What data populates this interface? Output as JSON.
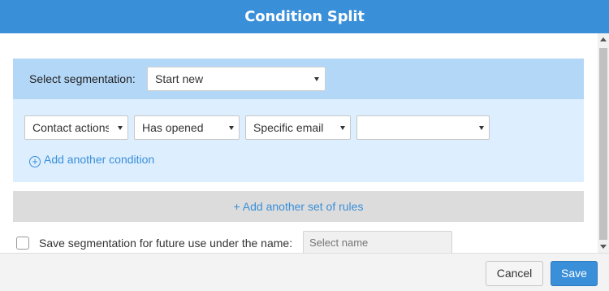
{
  "dialog": {
    "title": "Condition Split"
  },
  "segmentation": {
    "label": "Select segmentation:",
    "selected": "Start new"
  },
  "conditions": [
    {
      "field": "Contact actions"
    },
    {
      "field": "Has opened"
    },
    {
      "field": "Specific email"
    },
    {
      "field": ""
    }
  ],
  "add_condition_label": "Add another condition",
  "add_rule_set_label": "+ Add another set of rules",
  "save_segmentation": {
    "label": "Save segmentation for future use under the name:",
    "placeholder": "Select name",
    "checked": false
  },
  "footer": {
    "cancel_label": "Cancel",
    "save_label": "Save"
  },
  "colors": {
    "accent": "#3a8fd9",
    "segmentation_bar": "#b3d7f7",
    "rules_panel": "#ddeeff"
  }
}
